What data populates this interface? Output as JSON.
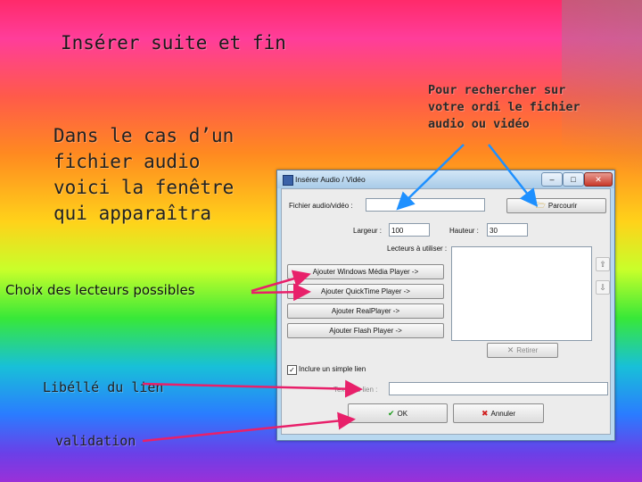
{
  "slide": {
    "title": "Insérer  suite et fin",
    "intro": "Dans le cas d’un fichier audio voici la fenêtre qui apparaîtra",
    "hint": "Pour rechercher sur votre ordi le fichier audio ou vidéo",
    "players_label": "Choix des lecteurs possibles",
    "link_label": "Libéllé du lien",
    "validation_label": "validation"
  },
  "dialog": {
    "title": "Insérer Audio / Vidéo",
    "file_label": "Fichier audio/vidéo :",
    "file_value": "",
    "browse_label": "Parcourir",
    "width_label": "Largeur :",
    "width_value": "100",
    "height_label": "Hauteur :",
    "height_value": "30",
    "players_list_label": "Lecteurs à utiliser :",
    "player_buttons": [
      "Ajouter Windows Média Player ->",
      "Ajouter QuickTime Player ->",
      "Ajouter RealPlayer ->",
      "Ajouter Flash Player ->"
    ],
    "remove_label": "Retirer",
    "include_link_label": "Inclure un simple lien",
    "include_link_checked": true,
    "link_text_label": "Texte du lien :",
    "link_text_value": "",
    "ok_label": "OK",
    "cancel_label": "Annuler"
  },
  "colors": {
    "arrow": "#e8206a",
    "hint_arrow": "#1e90ff",
    "ok_icon": "#1a9a1a",
    "cancel_icon": "#d02020"
  },
  "icons": [
    "app-icon",
    "folder-icon",
    "remove-icon",
    "ok-check-icon",
    "cancel-x-icon",
    "move-up-icon",
    "move-down-icon"
  ]
}
